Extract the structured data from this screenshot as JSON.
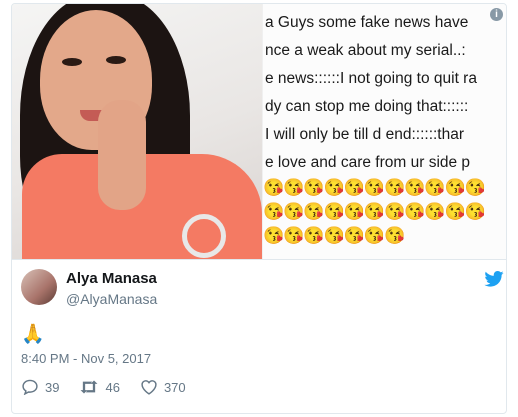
{
  "image_text": {
    "lines": [
      "a Guys some fake news have",
      "nce a weak about my serial..:",
      "e news::::::I not going to quit ra",
      "dy can stop me doing that::::::",
      "I will only be till d end::::::thar",
      "e love and care from ur side p"
    ],
    "emoji_row_1": "😘😘😘😘😘😘😘😘😘😘😘",
    "emoji_row_2": "😘😘😘😘😘😘😘😘😘😘😘",
    "emoji_row_3": "😘😘😘😘😘😘😘"
  },
  "tweet": {
    "display_name": "Alya Manasa",
    "handle": "@AlyaManasa",
    "text": "🙏",
    "timestamp": "8:40 PM - Nov 5, 2017"
  },
  "actions": {
    "replies": "39",
    "retweets": "46",
    "likes": "370"
  },
  "colors": {
    "twitter_blue": "#1da1f2",
    "muted": "#657786",
    "border": "#e1e8ed"
  },
  "icons": [
    "info-icon",
    "twitter-bird-icon",
    "reply-icon",
    "retweet-icon",
    "like-icon"
  ]
}
